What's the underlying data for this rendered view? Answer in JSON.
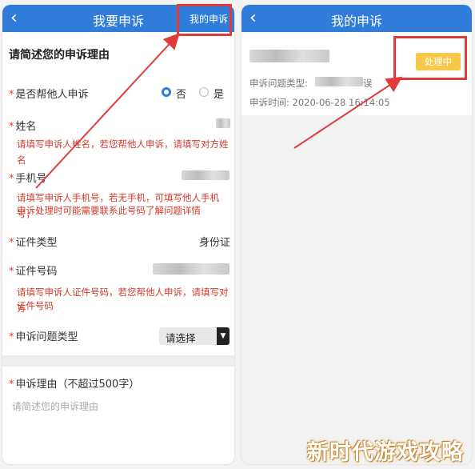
{
  "left": {
    "back_icon": "chevron-left-icon",
    "title": "我要申诉",
    "header_link": "我的申诉",
    "section_title": "请简述您的申诉理由",
    "appeal_for_other": {
      "label": "是否帮他人申诉",
      "option_no": "否",
      "option_yes": "是",
      "selected": "否"
    },
    "name": {
      "label": "姓名",
      "hint": "请填写申诉人姓名，若您帮他人申诉，请填写对方姓名"
    },
    "phone": {
      "label": "手机号",
      "hint_line1": "请填写申诉人手机号，若无手机，可填写他人手机号，",
      "hint_line2": "申诉处理时可能需要联系此号码了解问题详情"
    },
    "id_type": {
      "label": "证件类型",
      "value": "身份证"
    },
    "id_number": {
      "label": "证件号码",
      "hint_line1": "请填写申诉人证件号码，若您帮他人申诉，请填写对方",
      "hint_line2": "证件号码"
    },
    "issue_type": {
      "label": "申诉问题类型",
      "value": "请选择"
    },
    "reason": {
      "label": "申诉理由（不超过500字）",
      "placeholder": "请简述您的申诉理由"
    }
  },
  "right": {
    "back_icon": "chevron-left-icon",
    "title": "我的申诉",
    "issue_type_label": "申诉问题类型:",
    "issue_type_tail": "误",
    "time_label": "申诉时间:",
    "time_value": "2020-06-28 16:14:05",
    "status": "处理中"
  },
  "watermark": "新时代游戏攻略",
  "colors": {
    "header": "#2f7dd9",
    "hint": "#d33a2a",
    "status_badge": "#f7c84a",
    "highlight": "#e03a3a"
  }
}
